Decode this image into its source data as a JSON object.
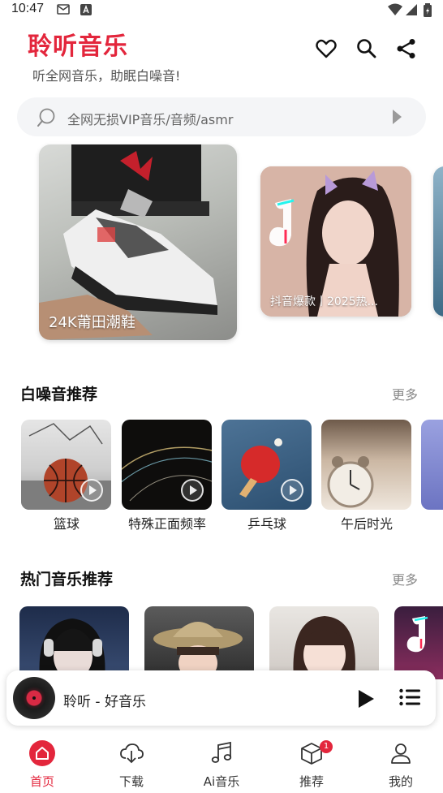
{
  "status_bar": {
    "time": "10:47"
  },
  "app": {
    "title": "聆听音乐",
    "subtitle": "听全网音乐，助眠白噪音!",
    "accent_color": "#e3263c"
  },
  "header_icons": [
    "heart-icon",
    "search-icon",
    "share-icon"
  ],
  "search": {
    "placeholder": "全网无损VIP音乐/音频/asmr"
  },
  "banner": {
    "cards": [
      {
        "caption": "24K莆田潮鞋"
      },
      {
        "caption": "抖音爆款丨2025热..."
      },
      {
        "caption": ""
      }
    ]
  },
  "white_noise": {
    "title": "白噪音推荐",
    "more": "更多",
    "items": [
      {
        "label": "篮球"
      },
      {
        "label": "特殊正面频率"
      },
      {
        "label": "乒乓球"
      },
      {
        "label": "午后时光"
      },
      {
        "label": ""
      }
    ]
  },
  "hot_music": {
    "title": "热门音乐推荐",
    "more": "更多"
  },
  "player": {
    "title": "聆听 - 好音乐"
  },
  "nav": {
    "items": [
      {
        "label": "首页",
        "icon": "home-icon",
        "active": true
      },
      {
        "label": "下载",
        "icon": "cloud-download-icon"
      },
      {
        "label": "Ai音乐",
        "icon": "music-note-icon"
      },
      {
        "label": "推荐",
        "icon": "cube-icon",
        "badge": "1"
      },
      {
        "label": "我的",
        "icon": "user-icon"
      }
    ]
  }
}
